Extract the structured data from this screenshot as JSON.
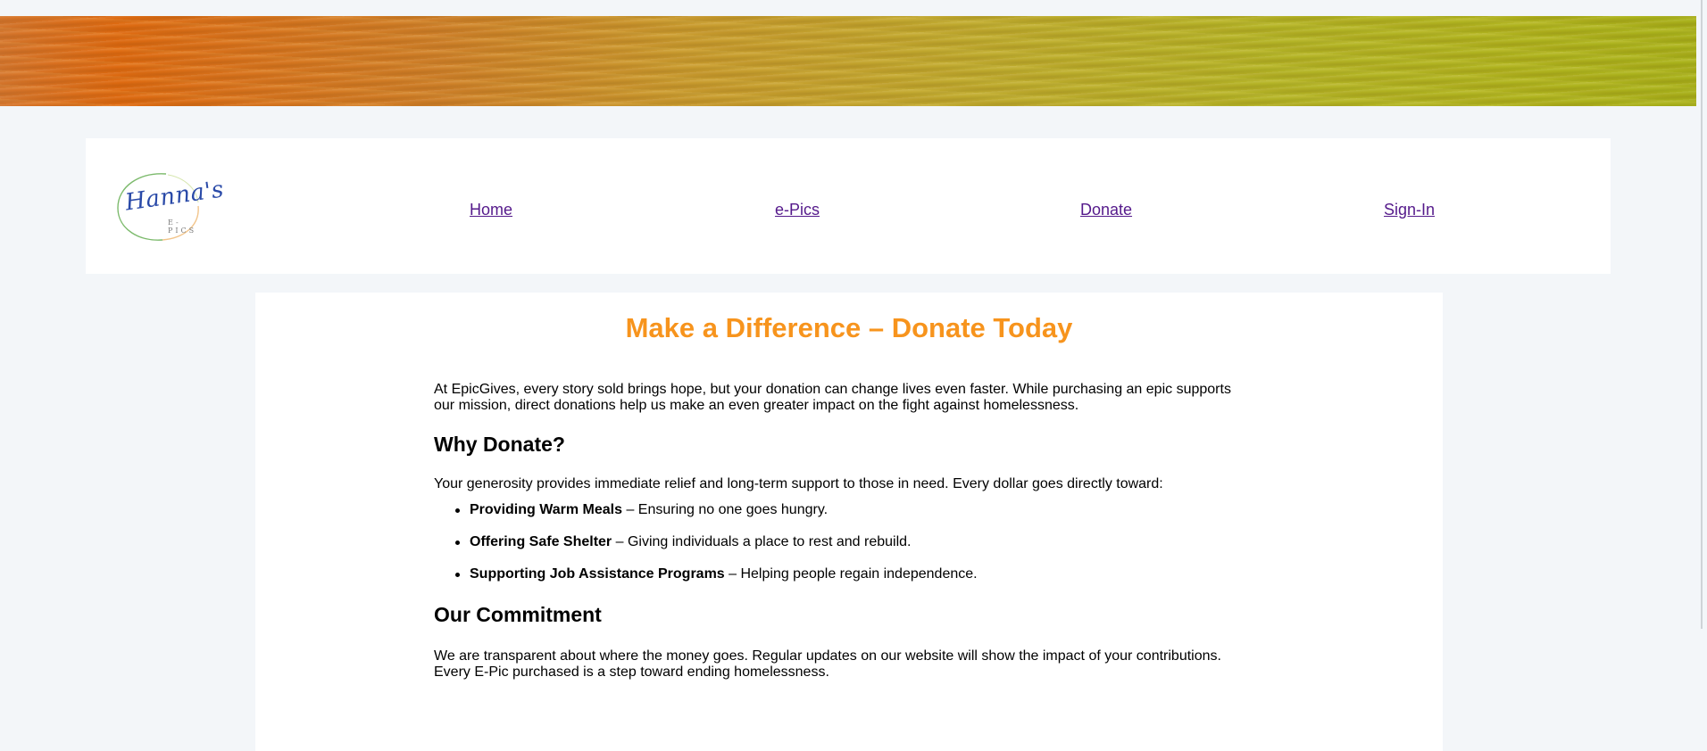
{
  "header": {
    "logo_script": "Hanna's",
    "logo_sub": "E-PICS",
    "nav": [
      {
        "label": "Home"
      },
      {
        "label": "e-Pics"
      },
      {
        "label": "Donate"
      },
      {
        "label": "Sign-In"
      }
    ],
    "nav_link_color": "#551a8b"
  },
  "main": {
    "title": "Make a Difference – Donate Today",
    "title_color": "#f7941d",
    "intro": "At EpicGives, every story sold brings hope, but your donation can change lives even faster. While purchasing an epic supports our mission, direct donations help us make an even greater impact on the fight against homelessness.",
    "why": {
      "heading": "Why Donate?",
      "text": "Your generosity provides immediate relief and long-term support to those in need. Every dollar goes directly toward:",
      "items": [
        {
          "bold": "Providing Warm Meals",
          "rest": " – Ensuring no one goes hungry."
        },
        {
          "bold": "Offering Safe Shelter",
          "rest": " – Giving individuals a place to rest and rebuild."
        },
        {
          "bold": "Supporting Job Assistance Programs",
          "rest": " – Helping people regain independence."
        }
      ]
    },
    "commitment": {
      "heading": "Our Commitment",
      "text": "We are transparent about where the money goes. Regular updates on our website will show the impact of your contributions. Every E-Pic purchased is a step toward ending homelessness."
    }
  },
  "colors": {
    "page_background": "#f3f6f9",
    "banner_orange": "#df6a10",
    "banner_green": "#a9b21a"
  }
}
